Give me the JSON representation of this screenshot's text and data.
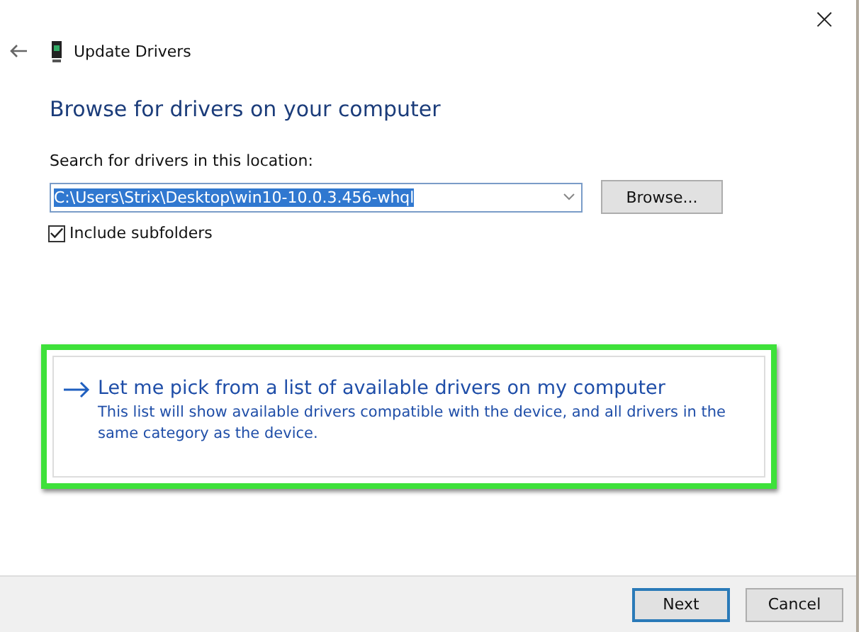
{
  "window": {
    "close_glyph": "×"
  },
  "header": {
    "title": "Update Drivers"
  },
  "heading": "Browse for drivers on your computer",
  "location": {
    "label": "Search for drivers in this location:",
    "value": "C:\\Users\\Strix\\Desktop\\win10-10.0.3.456-whql",
    "selected": true,
    "browse": "Browse..."
  },
  "include_subfolders": {
    "label": "Include subfolders",
    "checked": true
  },
  "pick_option": {
    "title": "Let me pick from a list of available drivers on my computer",
    "description": "This list will show available drivers compatible with the device, and all drivers in the same category as the device.",
    "highlighted": true
  },
  "buttons": [
    {
      "label": "Next",
      "default": true
    },
    {
      "label": "Cancel",
      "default": false
    }
  ]
}
